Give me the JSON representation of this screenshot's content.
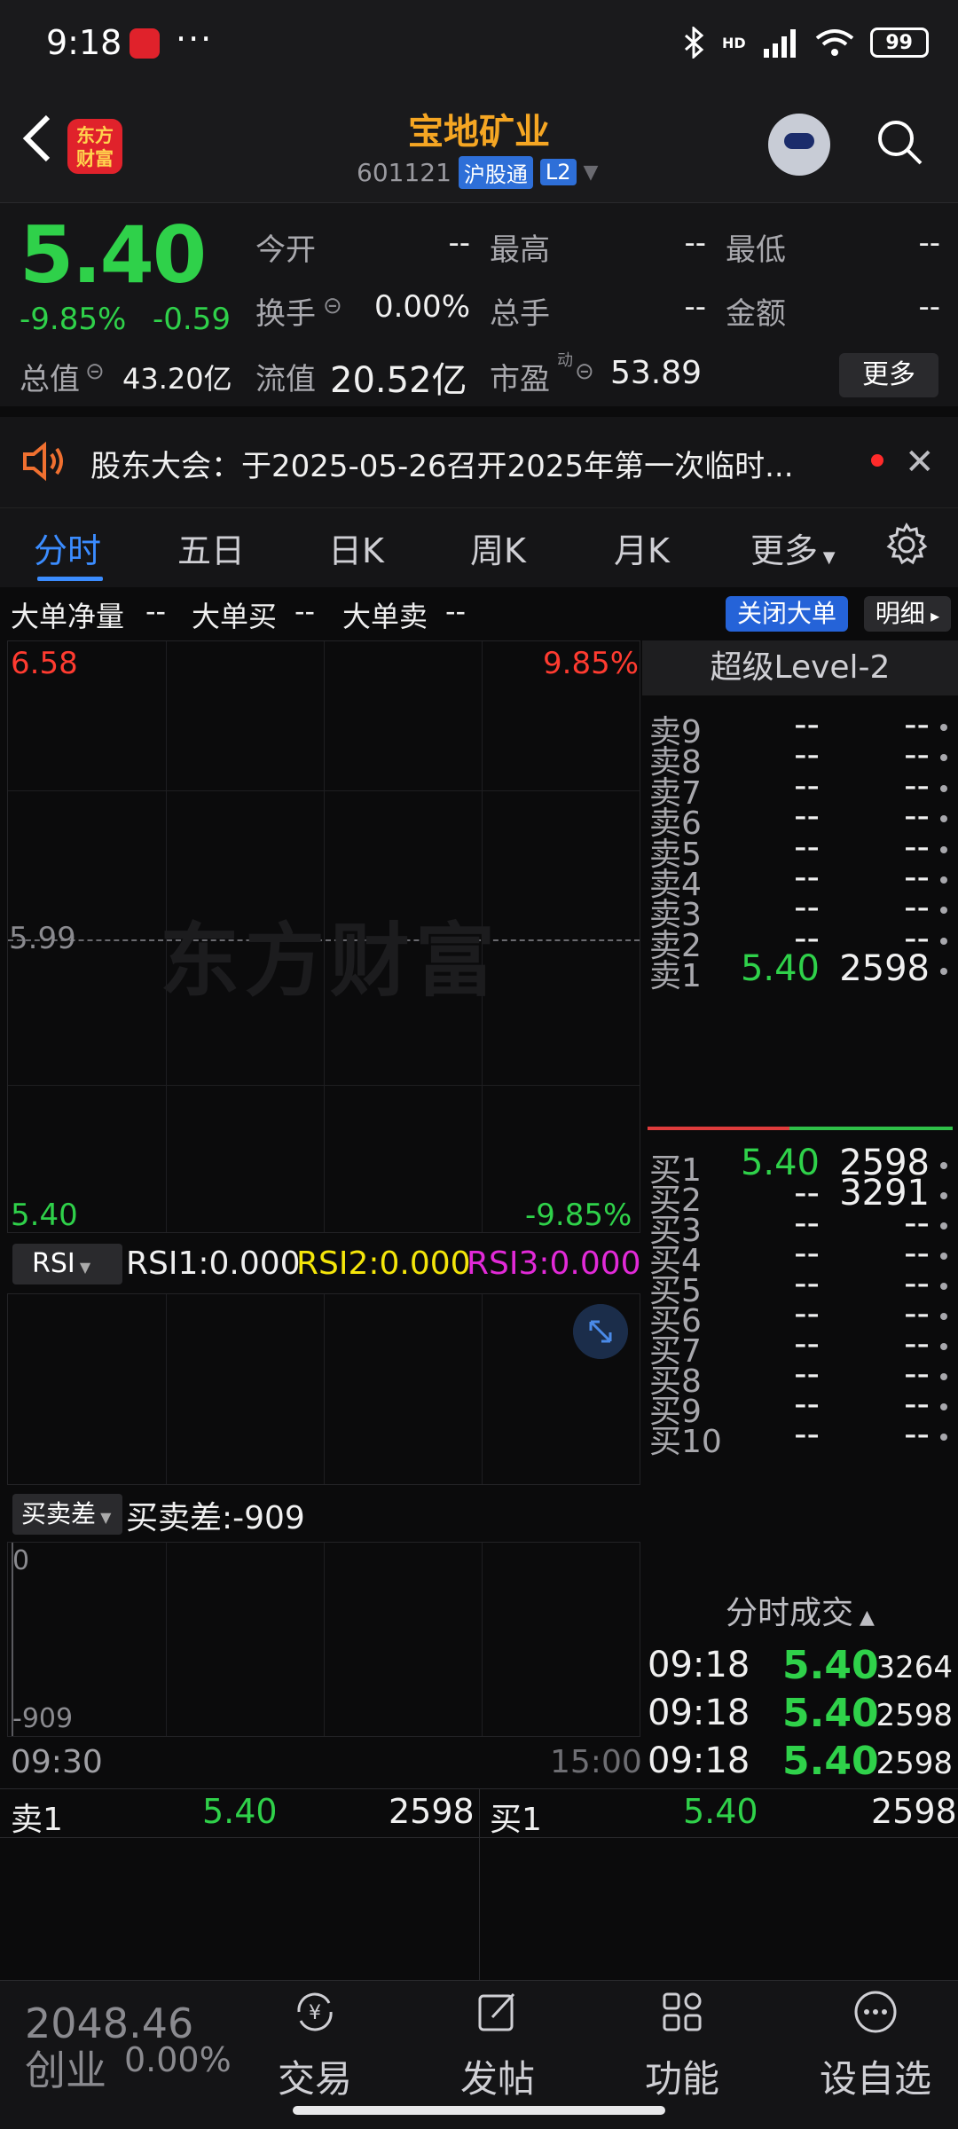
{
  "status_bar": {
    "time": "9:18",
    "dots": "···",
    "hd": "HD",
    "battery": "99"
  },
  "header": {
    "stock_name": "宝地矿业",
    "code": "601121",
    "tag1": "沪股通",
    "tag2": "L2",
    "logo_text": "东方财富"
  },
  "quote": {
    "price": "5.40",
    "change_pct": "-9.85%",
    "change": "-0.59",
    "open_label": "今开",
    "open_value": "--",
    "high_label": "最高",
    "high_value": "--",
    "low_label": "最低",
    "low_value": "--",
    "turnover_label": "换手",
    "turnover_value": "0.00%",
    "volume_label": "总手",
    "volume_value": "--",
    "amount_label": "金额",
    "amount_value": "--",
    "mktcap_label": "总值",
    "mktcap_value": "43.20亿",
    "float_label": "流值",
    "float_value": "20.52亿",
    "pe_label": "市盈",
    "pe_sup": "动",
    "pe_value": "53.89",
    "more": "更多"
  },
  "notice": {
    "text": "股东大会：于2025-05-26召开2025年第一次临时..."
  },
  "tabs": [
    "分时",
    "五日",
    "日K",
    "周K",
    "月K",
    "更多"
  ],
  "big_order": {
    "net_label": "大单净量",
    "net_value": "--",
    "buy_label": "大单买",
    "buy_value": "--",
    "sell_label": "大单卖",
    "sell_value": "--",
    "close_btn": "关闭大单",
    "detail_btn": "明细"
  },
  "chart": {
    "high": "6.58",
    "high_pct": "9.85%",
    "mid": "5.99",
    "low": "5.40",
    "low_pct": "-9.85%",
    "watermark": "东方财富",
    "time_start": "09:30",
    "time_end": "15:00"
  },
  "rsi": {
    "selector": "RSI",
    "rsi1": "RSI1:0.000",
    "rsi2": "RSI2:0.000",
    "rsi3": "RSI3:0.000"
  },
  "spread": {
    "selector": "买卖差",
    "label": "买卖差:-909",
    "top": "0",
    "bottom": "-909"
  },
  "order_book": {
    "title": "超级Level-2",
    "asks": [
      {
        "label": "卖9",
        "price": "--",
        "vol": "--"
      },
      {
        "label": "卖8",
        "price": "--",
        "vol": "--"
      },
      {
        "label": "卖7",
        "price": "--",
        "vol": "--"
      },
      {
        "label": "卖6",
        "price": "--",
        "vol": "--"
      },
      {
        "label": "卖5",
        "price": "--",
        "vol": "--"
      },
      {
        "label": "卖4",
        "price": "--",
        "vol": "--"
      },
      {
        "label": "卖3",
        "price": "--",
        "vol": "--"
      },
      {
        "label": "卖2",
        "price": "--",
        "vol": "--"
      },
      {
        "label": "卖1",
        "price": "5.40",
        "vol": "2598"
      }
    ],
    "bids": [
      {
        "label": "买1",
        "price": "5.40",
        "vol": "2598"
      },
      {
        "label": "买2",
        "price": "--",
        "vol": "3291"
      },
      {
        "label": "买3",
        "price": "--",
        "vol": "--"
      },
      {
        "label": "买4",
        "price": "--",
        "vol": "--"
      },
      {
        "label": "买5",
        "price": "--",
        "vol": "--"
      },
      {
        "label": "买6",
        "price": "--",
        "vol": "--"
      },
      {
        "label": "买7",
        "price": "--",
        "vol": "--"
      },
      {
        "label": "买8",
        "price": "--",
        "vol": "--"
      },
      {
        "label": "买9",
        "price": "--",
        "vol": "--"
      },
      {
        "label": "买10",
        "price": "--",
        "vol": "--"
      }
    ]
  },
  "ticks": {
    "title": "分时成交",
    "rows": [
      {
        "time": "09:18",
        "price": "5.40",
        "vol": "3264"
      },
      {
        "time": "09:18",
        "price": "5.40",
        "vol": "2598"
      },
      {
        "time": "09:18",
        "price": "5.40",
        "vol": "2598"
      }
    ]
  },
  "bottom_quote": {
    "sell_label": "卖1",
    "sell_price": "5.40",
    "sell_vol": "2598",
    "buy_label": "买1",
    "buy_price": "5.40",
    "buy_vol": "2598"
  },
  "index": {
    "value": "2048.46",
    "name": "创业",
    "pct": "0.00%"
  },
  "nav": [
    {
      "label": "交易",
      "icon": "yen-exchange-icon"
    },
    {
      "label": "发帖",
      "icon": "edit-post-icon"
    },
    {
      "label": "功能",
      "icon": "grid-apps-icon"
    },
    {
      "label": "设自选",
      "icon": "more-dots-icon"
    }
  ],
  "colors": {
    "up": "#ff3b30",
    "down": "#2fd14a",
    "accent": "#3b8cff",
    "brand": "#e0222b",
    "name": "#f5a623"
  }
}
